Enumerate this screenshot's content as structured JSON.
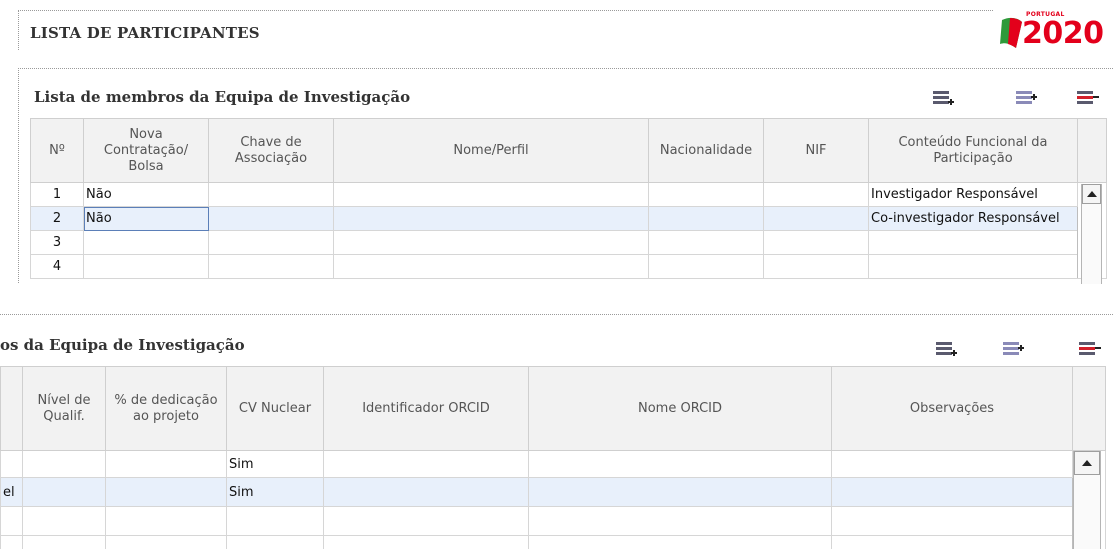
{
  "header": {
    "title": "LISTA DE PARTICIPANTES",
    "logo": {
      "small_text": "PORTUGAL",
      "year_text": "2020"
    }
  },
  "panel_top": {
    "title": "Lista de membros da Equipa de Investigação",
    "toolbar": [
      "insert-row-icon",
      "add-row-icon",
      "delete-row-icon"
    ],
    "columns": [
      "Nº",
      "Nova Contratação/ Bolsa",
      "Chave de Associação",
      "Nome/Perfil",
      "Nacionalidade",
      "NIF",
      "Conteúdo Funcional da Participação"
    ],
    "rows": [
      [
        "1",
        "Não",
        "",
        "",
        "",
        "",
        "Investigador Responsável"
      ],
      [
        "2",
        "Não",
        "",
        "",
        "",
        "",
        "Co-investigador Responsável"
      ],
      [
        "3",
        "",
        "",
        "",
        "",
        "",
        ""
      ],
      [
        "4",
        "",
        "",
        "",
        "",
        "",
        ""
      ]
    ]
  },
  "panel_bottom": {
    "title": "os da Equipa de Investigação",
    "toolbar": [
      "insert-row-icon",
      "add-row-icon",
      "delete-row-icon"
    ],
    "columns": [
      "Nível de Qualif.",
      "% de dedicação ao projeto",
      "CV Nuclear",
      "Identificador ORCID",
      "Nome ORCID",
      "Observações"
    ],
    "rows": [
      [
        "",
        "",
        "",
        "Sim",
        "",
        "",
        ""
      ],
      [
        "el",
        "",
        "",
        "Sim",
        "",
        "",
        ""
      ],
      [
        "",
        "",
        "",
        "",
        "",
        "",
        ""
      ],
      [
        "",
        "",
        "",
        "",
        "",
        "",
        ""
      ]
    ]
  },
  "colors": {
    "brand_red": "#e3001b",
    "brand_green": "#2e9a3a",
    "selected_row": "#e8f0fb"
  }
}
